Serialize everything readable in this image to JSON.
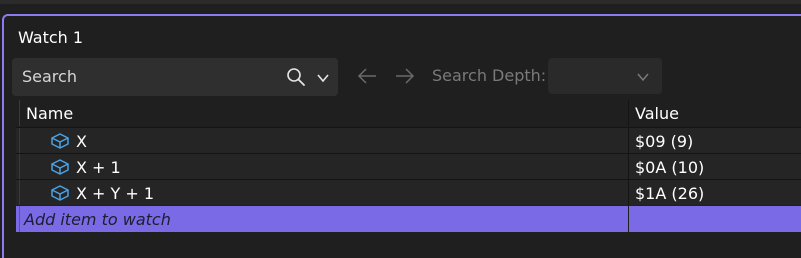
{
  "panel": {
    "title": "Watch 1",
    "accent_color": "#8a7cf0"
  },
  "toolbar": {
    "search_placeholder": "Search",
    "search_icon": "search-icon",
    "dropdown_icon": "chevron-down-icon",
    "back_icon": "arrow-left-icon",
    "forward_icon": "arrow-right-icon",
    "depth_label": "Search Depth:",
    "depth_value": ""
  },
  "grid": {
    "columns": [
      "Name",
      "Value"
    ],
    "rows": [
      {
        "icon": "cube-icon",
        "name": "X",
        "value": "$09 (9)"
      },
      {
        "icon": "cube-icon",
        "name": "X + 1",
        "value": "$0A (10)"
      },
      {
        "icon": "cube-icon",
        "name": "X + Y + 1",
        "value": "$1A (26)"
      }
    ],
    "add_item_placeholder": "Add item to watch",
    "add_row_color": "#7b6ae6",
    "icon_color": "#4aa3e8"
  }
}
